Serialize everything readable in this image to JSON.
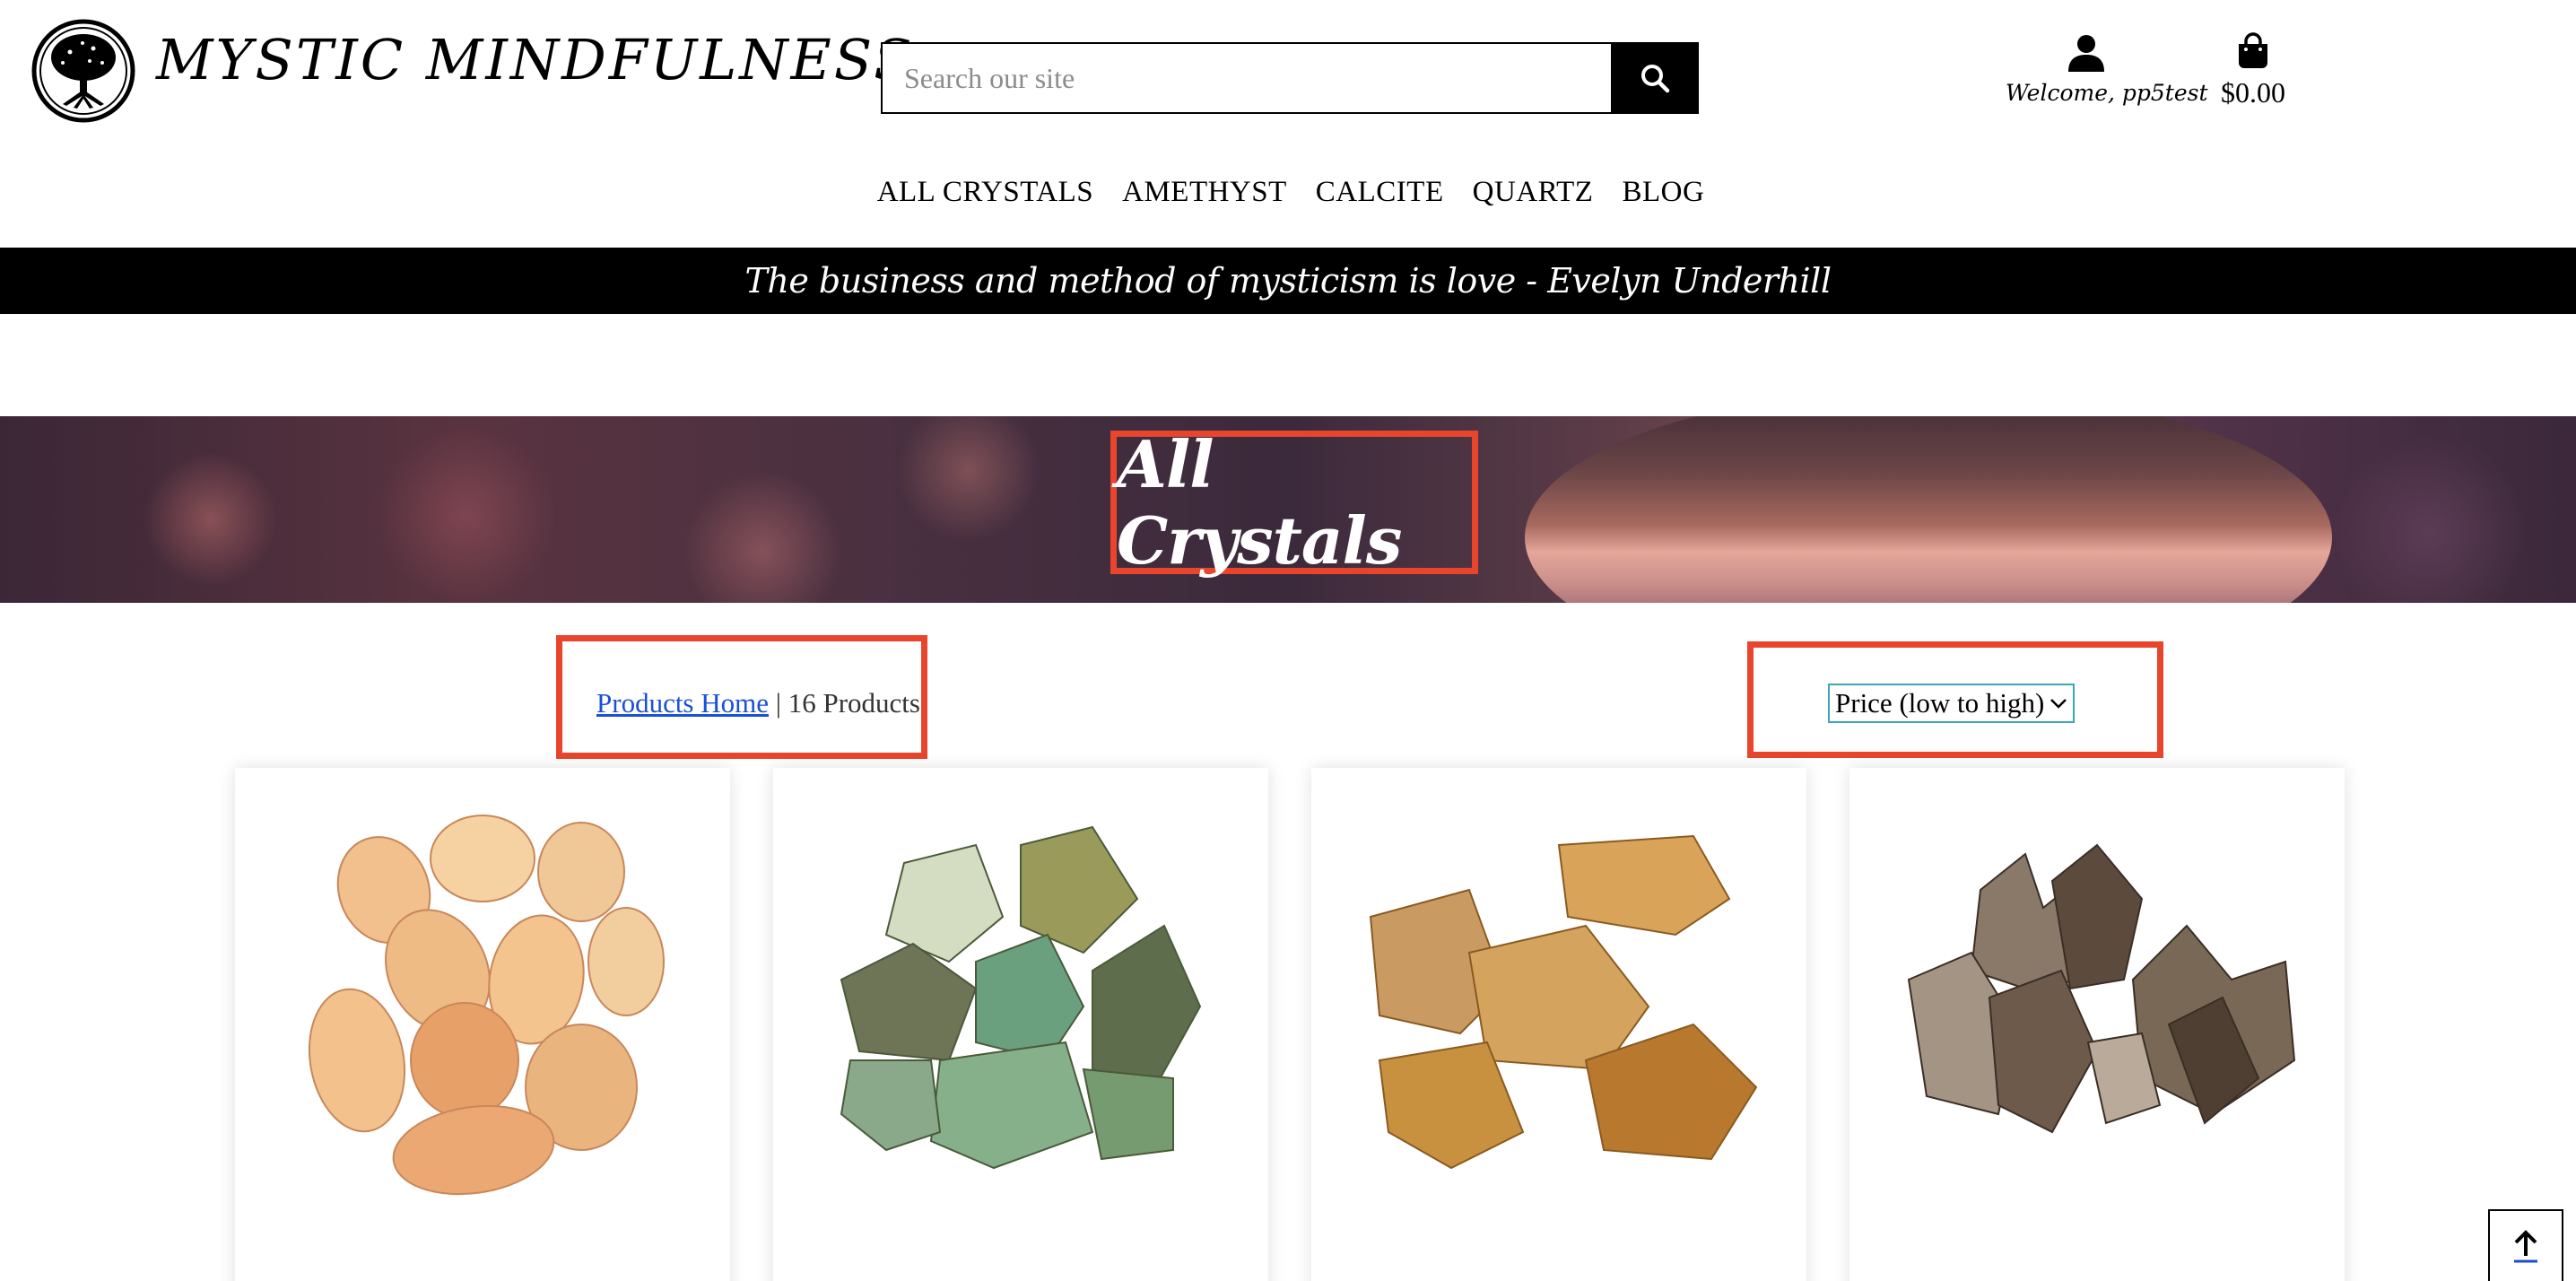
{
  "header": {
    "brand": "MYSTIC MINDFULNESS",
    "search_placeholder": "Search our site",
    "account_label": "Welcome, pp5test",
    "bag_total": "$0.00"
  },
  "nav": {
    "items": [
      "ALL CRYSTALS",
      "AMETHYST",
      "CALCITE",
      "QUARTZ",
      "BLOG"
    ]
  },
  "quote": "The business and method of mysticism is love - Evelyn Underhill",
  "hero": {
    "title": "All Crystals"
  },
  "toolbar": {
    "breadcrumb_link": "Products Home",
    "separator": "|",
    "product_count": "16 Products",
    "sort_selected": "Price (low to high)"
  },
  "products": [
    {
      "image": "orange-tumbled-stones"
    },
    {
      "image": "green-raw-crystals"
    },
    {
      "image": "honey-calcite-chunks"
    },
    {
      "image": "smoky-quartz-clusters"
    }
  ],
  "colors": {
    "highlight": "#e8452c",
    "link": "#1a4fd6",
    "select_border": "#3aa6b9"
  }
}
